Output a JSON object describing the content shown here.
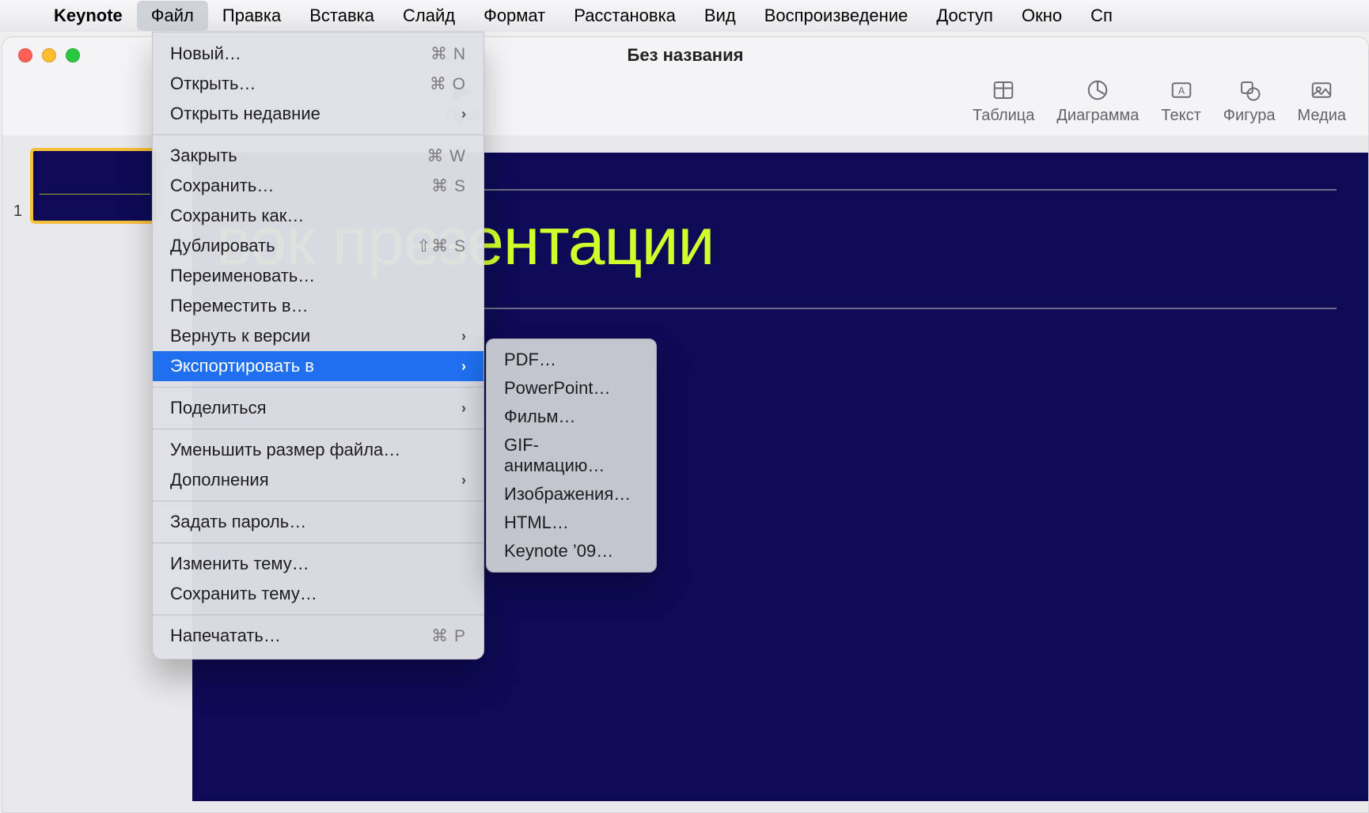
{
  "menubar": {
    "app_name": "Keynote",
    "items": [
      "Файл",
      "Правка",
      "Вставка",
      "Слайд",
      "Формат",
      "Расстановка",
      "Вид",
      "Воспроизведение",
      "Доступ",
      "Окно",
      "Сп"
    ]
  },
  "window": {
    "title": "Без названия"
  },
  "toolbar": {
    "play": "Пуск",
    "table": "Таблица",
    "chart": "Диаграмма",
    "text": "Текст",
    "shape": "Фигура",
    "media": "Медиа"
  },
  "navigator": {
    "slide_number": "1"
  },
  "slide": {
    "title_visible": "вок презентации"
  },
  "file_menu": {
    "groups": [
      [
        {
          "label": "Новый…",
          "shortcut": "⌘ N"
        },
        {
          "label": "Открыть…",
          "shortcut": "⌘ O"
        },
        {
          "label": "Открыть недавние",
          "submenu": true
        }
      ],
      [
        {
          "label": "Закрыть",
          "shortcut": "⌘ W"
        },
        {
          "label": "Сохранить…",
          "shortcut": "⌘ S"
        },
        {
          "label": "Сохранить как…"
        },
        {
          "label": "Дублировать",
          "shortcut": "⇧⌘ S"
        },
        {
          "label": "Переименовать…"
        },
        {
          "label": "Переместить в…"
        },
        {
          "label": "Вернуть к версии",
          "submenu": true
        },
        {
          "label": "Экспортировать в",
          "submenu": true,
          "highlight": true
        }
      ],
      [
        {
          "label": "Поделиться",
          "submenu": true
        }
      ],
      [
        {
          "label": "Уменьшить размер файла…"
        },
        {
          "label": "Дополнения",
          "submenu": true
        }
      ],
      [
        {
          "label": "Задать пароль…"
        }
      ],
      [
        {
          "label": "Изменить тему…"
        },
        {
          "label": "Сохранить тему…"
        }
      ],
      [
        {
          "label": "Напечатать…",
          "shortcut": "⌘ P"
        }
      ]
    ]
  },
  "export_submenu": [
    "PDF…",
    "PowerPoint…",
    "Фильм…",
    "GIF-анимацию…",
    "Изображения…",
    "HTML…",
    "Keynote ’09…"
  ]
}
